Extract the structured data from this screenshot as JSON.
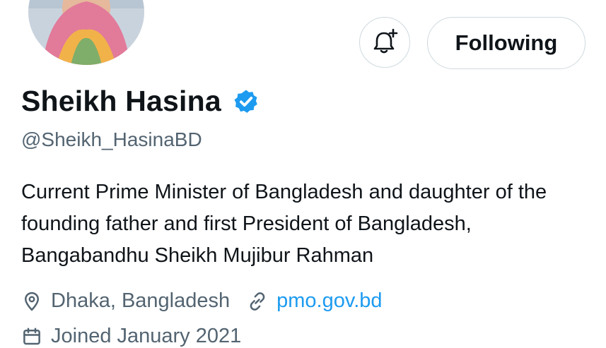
{
  "profile": {
    "display_name": "Sheikh Hasina",
    "handle": "@Sheikh_HasinaBD",
    "bio": "Current Prime Minister of Bangladesh and daughter of the founding father and first President of Bangladesh, Bangabandhu Sheikh Mujibur Rahman",
    "location": "Dhaka, Bangladesh",
    "website": "pmo.gov.bd",
    "joined": "Joined January 2021",
    "verified_color": "#1d9bf0"
  },
  "actions": {
    "follow_label": "Following",
    "notify_icon": "bell-plus-icon"
  },
  "colors": {
    "text_primary": "#0f1419",
    "text_secondary": "#536471",
    "accent": "#1d9bf0",
    "border": "#cfd9de"
  }
}
